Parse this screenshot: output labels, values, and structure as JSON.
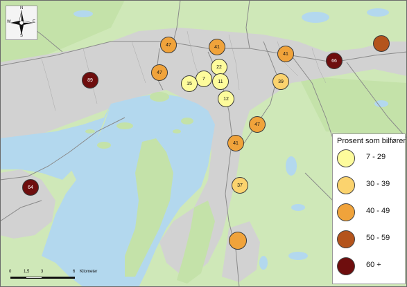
{
  "legend": {
    "title": "Prosent som bilfører",
    "classes": [
      {
        "label": "7 - 29",
        "color": "#fdfb9c"
      },
      {
        "label": "30 - 39",
        "color": "#fbd36e"
      },
      {
        "label": "40 - 49",
        "color": "#f0a33b"
      },
      {
        "label": "50 - 59",
        "color": "#b4541c"
      },
      {
        "label": "60 +",
        "color": "#6e0e0e"
      }
    ]
  },
  "north_arrow": {
    "n": "N",
    "s": "S",
    "e": "E",
    "w": "W",
    "icon": "compass-rose-icon"
  },
  "scale_bar": {
    "ticks": [
      "0",
      "1,5",
      "3",
      "6"
    ],
    "units": "Kilometer"
  },
  "markers": [
    {
      "label": "47",
      "class": 2
    },
    {
      "label": "41",
      "class": 2
    },
    {
      "label": "41",
      "class": 2
    },
    {
      "label": "",
      "class": 3
    },
    {
      "label": "66",
      "class": 4
    },
    {
      "label": "47",
      "class": 2
    },
    {
      "label": "89",
      "class": 4
    },
    {
      "label": "22",
      "class": 0
    },
    {
      "label": "7",
      "class": 0
    },
    {
      "label": "15",
      "class": 0
    },
    {
      "label": "11",
      "class": 0
    },
    {
      "label": "39",
      "class": 1
    },
    {
      "label": "12",
      "class": 0
    },
    {
      "label": "47",
      "class": 2
    },
    {
      "label": "41",
      "class": 2
    },
    {
      "label": "37",
      "class": 1
    },
    {
      "label": "64",
      "class": 4
    },
    {
      "label": "",
      "class": 2
    }
  ],
  "colors": {
    "land": "#cfe8b8",
    "water": "#b3d8ee",
    "urban": "#d2d2d2",
    "roads": "#8a8a8a"
  }
}
